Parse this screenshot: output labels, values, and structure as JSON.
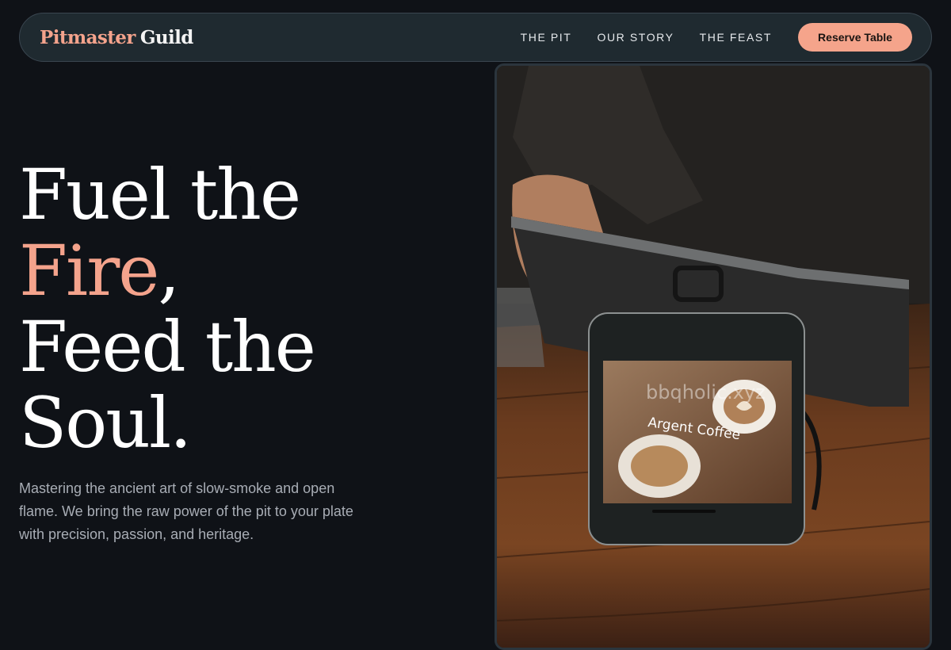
{
  "brand": {
    "part1": "Pitmaster",
    "part2": "Guild"
  },
  "nav": {
    "links": [
      "THE PIT",
      "OUR STORY",
      "THE FEAST"
    ],
    "cta": "Reserve Table"
  },
  "hero": {
    "line1": "Fuel the",
    "line2_accent": "Fire",
    "line2_rest": ",",
    "line3": "Feed the",
    "line4": "Soul.",
    "description": "Mastering the ancient art of slow-smoke and open flame. We bring the raw power of the pit to your plate with precision, passion, and heritage."
  },
  "image": {
    "screen_watermark": "bbqholic.xyz",
    "screen_caption": "Argent Coffee"
  },
  "colors": {
    "background": "#0f1217",
    "accent": "#f4a38c",
    "nav_bg": "#1f2a30",
    "button_bg": "#f5a48b"
  }
}
